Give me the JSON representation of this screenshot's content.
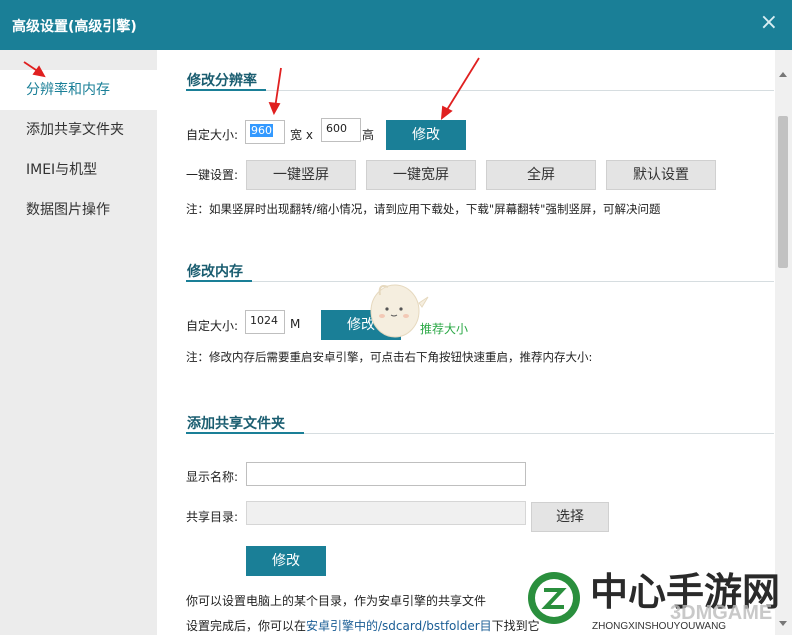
{
  "window": {
    "title": "高级设置(高级引擎)",
    "close_icon": "×"
  },
  "sidebar": {
    "items": [
      {
        "label": "分辨率和内存"
      },
      {
        "label": "添加共享文件夹"
      },
      {
        "label": "IMEI与机型"
      },
      {
        "label": "数据图片操作"
      }
    ]
  },
  "resolution": {
    "title": "修改分辨率",
    "custom_label": "自定大小:",
    "width_value": "960",
    "width_unit": "宽 x",
    "height_value": "600",
    "height_unit": "高",
    "modify_button": "修改",
    "preset_label": "一键设置:",
    "presets": [
      "一键竖屏",
      "一键宽屏",
      "全屏",
      "默认设置"
    ],
    "note": "注：如果竖屏时出现翻转/缩小情况，请到应用下载处，下载\"屏幕翻转\"强制竖屏，可解决问题"
  },
  "memory": {
    "title": "修改内存",
    "custom_label": "自定大小:",
    "value": "1024",
    "unit": "M",
    "modify_button": "修改",
    "recommend_link": "推荐大小",
    "note": "注：修改内存后需要重启安卓引擎，可点击右下角按钮快速重启，推荐内存大小:"
  },
  "shared_folder": {
    "title": "添加共享文件夹",
    "display_name_label": "显示名称:",
    "display_name_value": "",
    "share_dir_label": "共享目录:",
    "share_dir_value": "",
    "choose_button": "选择",
    "modify_button": "修改",
    "help_line1": "你可以设置电脑上的某个目录，作为安卓引擎的共享文件",
    "help_line2_prefix": "设置完成后，你可以在",
    "help_line2_link": "安卓引擎中的/sdcard/bstfolder目",
    "help_line2_suffix": "下找到它"
  },
  "watermark": {
    "brand": "中心手游网",
    "sub": "ZHONGXINSHOUYOUWANG",
    "overlay": "3DMGAME"
  },
  "colors": {
    "accent": "#1a7f97",
    "title_text": "#1a5d70",
    "green_link": "#2aa845",
    "annotation_arrow": "#e02020"
  }
}
